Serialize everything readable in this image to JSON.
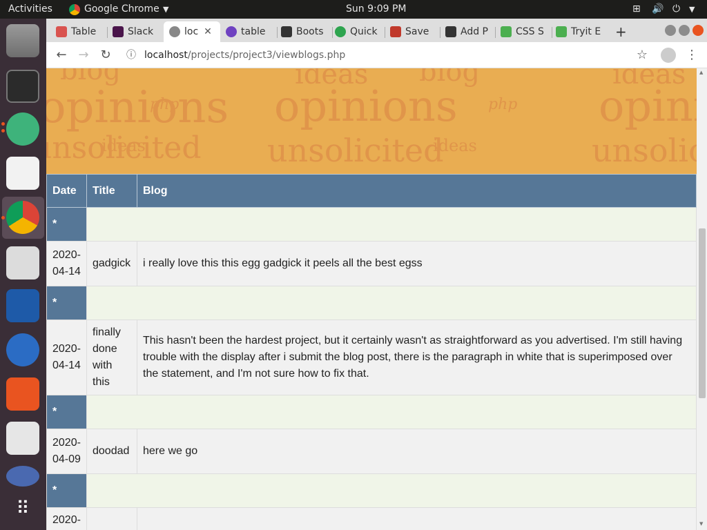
{
  "topbar": {
    "activities": "Activities",
    "app_name": "Google Chrome",
    "clock": "Sun  9:09 PM"
  },
  "tabs": [
    {
      "label": "Table",
      "color": "#d9534f"
    },
    {
      "label": "Slack",
      "color": "#4a154b"
    },
    {
      "label": "loc",
      "color": "#888888"
    },
    {
      "label": "table",
      "color": "#6f42c1"
    },
    {
      "label": "Boots",
      "color": "#333333"
    },
    {
      "label": "Quick",
      "color": "#2ea44f"
    },
    {
      "label": "Save",
      "color": "#c0392b"
    },
    {
      "label": "Add P",
      "color": "#333333"
    },
    {
      "label": "CSS S",
      "color": "#4caf50"
    },
    {
      "label": "Tryit E",
      "color": "#4caf50"
    }
  ],
  "browser": {
    "url_host": "localhost",
    "url_path": "/projects/project3/viewblogs.php"
  },
  "banner_words": [
    "blog",
    "opinions",
    "ideas",
    "unsolicited",
    "php"
  ],
  "table": {
    "headers": {
      "date": "Date",
      "title": "Title",
      "blog": "Blog"
    },
    "star_marker": "*",
    "rows": [
      {
        "date": "2020-04-14",
        "title": "gadgick",
        "blog": "i really love this this egg gadgick it peels all the best egss"
      },
      {
        "date": "2020-04-14",
        "title": "finally done with this",
        "blog": "This hasn't been the hardest project, but it certainly wasn't as straightforward as you advertised. I'm still having trouble with the display after i submit the blog post, there is the paragraph in white that is superimposed over the statement, and I'm not sure how to fix that."
      },
      {
        "date": "2020-04-09",
        "title": "doodad",
        "blog": "here we go"
      },
      {
        "date": "2020-",
        "title": "",
        "blog": ""
      }
    ]
  },
  "colors": {
    "header_bg": "#567797",
    "banner_bg": "#e9ad52",
    "star_row_bg": "#f0f5e8"
  }
}
